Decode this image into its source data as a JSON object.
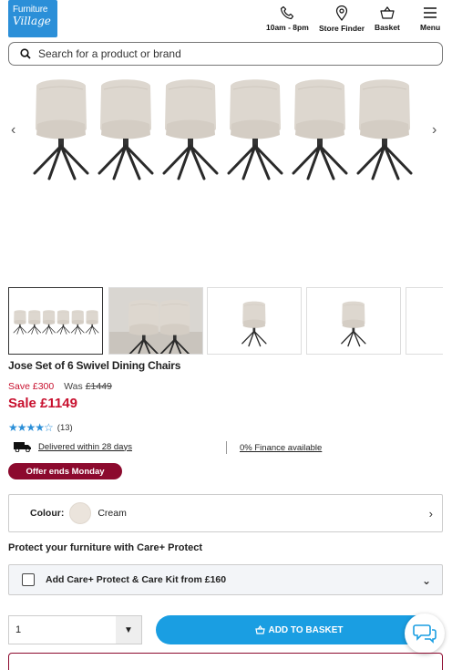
{
  "header": {
    "logo_line1": "Furniture",
    "logo_line2": "Village",
    "hours": "10am - 8pm",
    "store_finder": "Store Finder",
    "basket": "Basket",
    "menu": "Menu"
  },
  "search": {
    "placeholder": "Search for a product or brand"
  },
  "product": {
    "title": "Jose Set of 6 Swivel Dining Chairs",
    "save": "Save £300",
    "was_label": "Was",
    "was_price": "£1449",
    "sale": "Sale £1149",
    "review_count": "(13)",
    "rating": 4.5,
    "delivery": "Delivered within 28 days",
    "finance": "0% Finance available",
    "offer": "Offer ends Monday"
  },
  "colour": {
    "label": "Colour:",
    "value": "Cream",
    "swatch_color": "#ebe4dc"
  },
  "protect": {
    "title": "Protect your furniture with Care+ Protect",
    "option": "Add Care+ Protect & Care Kit from £160"
  },
  "purchase": {
    "quantity": "1",
    "add_label": "ADD TO BASKET"
  },
  "colors": {
    "brand_blue": "#2b8fd8",
    "sale_red": "#c8102e",
    "offer_maroon": "#8c0a2e",
    "button_blue": "#1a9ee2"
  }
}
